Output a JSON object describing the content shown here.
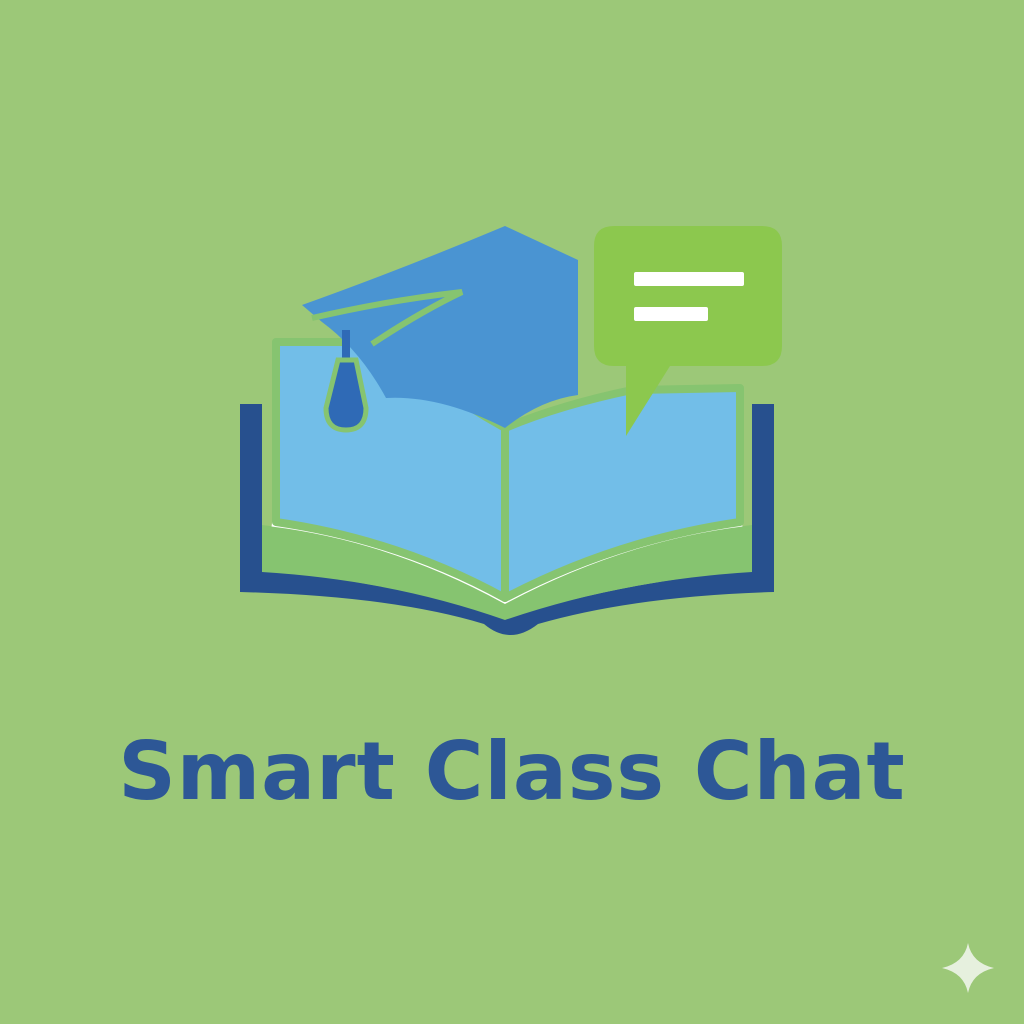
{
  "logo": {
    "brand_name": "Smart Class Chat",
    "icon_name": "graduation-cap-book-chat-logo"
  },
  "colors": {
    "background": "#9cc878",
    "brand_text": "#2d5796",
    "cap": "#4a94d2",
    "cap_tassel": "#2f6ab6",
    "book_page": "#72bee8",
    "book_cover": "#27508e",
    "book_outline": "#86c470",
    "chat_bubble": "#8cc84e",
    "chat_lines": "#ffffff",
    "sparkle": "#e6f0de"
  }
}
